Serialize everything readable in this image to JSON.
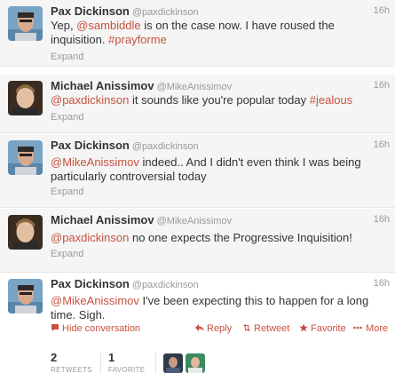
{
  "tweets": [
    {
      "fullname": "Pax Dickinson",
      "username": "@paxdickinson",
      "time": "16h",
      "segments": [
        {
          "t": "Yep, "
        },
        {
          "t": "@sambiddle",
          "link": true
        },
        {
          "t": " is on the case now. I have roused the inquisition. "
        },
        {
          "t": "#prayforme",
          "link": true
        }
      ],
      "expand": "Expand"
    },
    {
      "fullname": "Michael Anissimov",
      "username": "@MikeAnissimov",
      "time": "16h",
      "segments": [
        {
          "t": "@paxdickinson",
          "link": true
        },
        {
          "t": " it sounds like you're popular today "
        },
        {
          "t": "#jealous",
          "link": true
        }
      ],
      "expand": "Expand"
    },
    {
      "fullname": "Pax Dickinson",
      "username": "@paxdickinson",
      "time": "16h",
      "segments": [
        {
          "t": "@MikeAnissimov",
          "link": true
        },
        {
          "t": " indeed..  And I didn't even think I was being particularly controversial today"
        }
      ],
      "expand": "Expand"
    },
    {
      "fullname": "Michael Anissimov",
      "username": "@MikeAnissimov",
      "time": "16h",
      "segments": [
        {
          "t": "@paxdickinson",
          "link": true
        },
        {
          "t": " no one expects the Progressive Inquisition!"
        }
      ],
      "expand": "Expand"
    },
    {
      "fullname": "Pax Dickinson",
      "username": "@paxdickinson",
      "time": "16h",
      "segments": [
        {
          "t": "@MikeAnissimov",
          "link": true
        },
        {
          "t": " I've been expecting this to happen for a long time. Sigh."
        }
      ]
    }
  ],
  "actions": {
    "hide_conversation": "Hide conversation",
    "reply": "Reply",
    "retweet": "Retweet",
    "favorite": "Favorite",
    "more": "More"
  },
  "stats": {
    "retweets_count": "2",
    "retweets_label": "RETWEETS",
    "favorites_count": "1",
    "favorites_label": "FAVORITE"
  },
  "colors": {
    "link": "#c9513f",
    "muted": "#999999",
    "text": "#333333",
    "background": "#f5f5f5"
  },
  "icons": [
    "chat-bubble-icon",
    "reply-arrow-icon",
    "retweet-icon",
    "star-icon",
    "more-dots-icon"
  ]
}
